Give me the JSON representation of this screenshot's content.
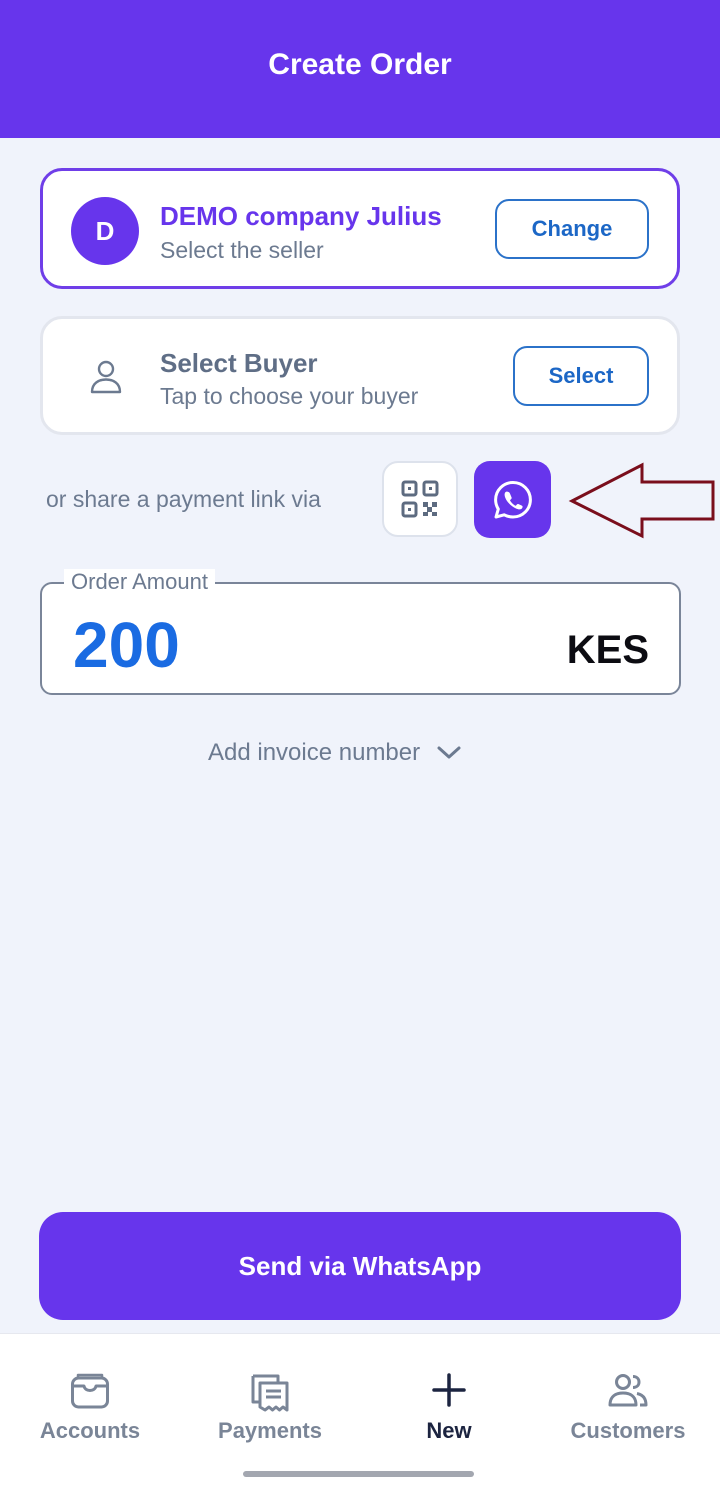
{
  "header": {
    "title": "Create Order"
  },
  "seller": {
    "avatar_letter": "D",
    "name": "DEMO company Julius",
    "subtitle": "Select the seller",
    "change_label": "Change"
  },
  "buyer": {
    "title": "Select Buyer",
    "subtitle": "Tap to choose your buyer",
    "select_label": "Select"
  },
  "share": {
    "text": "or share a payment link via",
    "qr_icon": "qr-code-icon",
    "whatsapp_icon": "whatsapp-icon"
  },
  "order": {
    "amount_label": "Order Amount",
    "amount_value": "200",
    "currency": "KES"
  },
  "invoice": {
    "toggle_label": "Add invoice number"
  },
  "send_button": {
    "label": "Send via WhatsApp"
  },
  "bottom_nav": {
    "items": [
      {
        "label": "Accounts",
        "icon": "wallet-icon"
      },
      {
        "label": "Payments",
        "icon": "receipt-icon"
      },
      {
        "label": "New",
        "icon": "plus-icon",
        "active": true
      },
      {
        "label": "Customers",
        "icon": "people-icon"
      }
    ]
  },
  "colors": {
    "primary": "#6735ec",
    "link_blue": "#1c67c6",
    "amount_blue": "#1a6be2",
    "background": "#f0f3fb",
    "annotation_arrow": "#7a0e1c"
  }
}
